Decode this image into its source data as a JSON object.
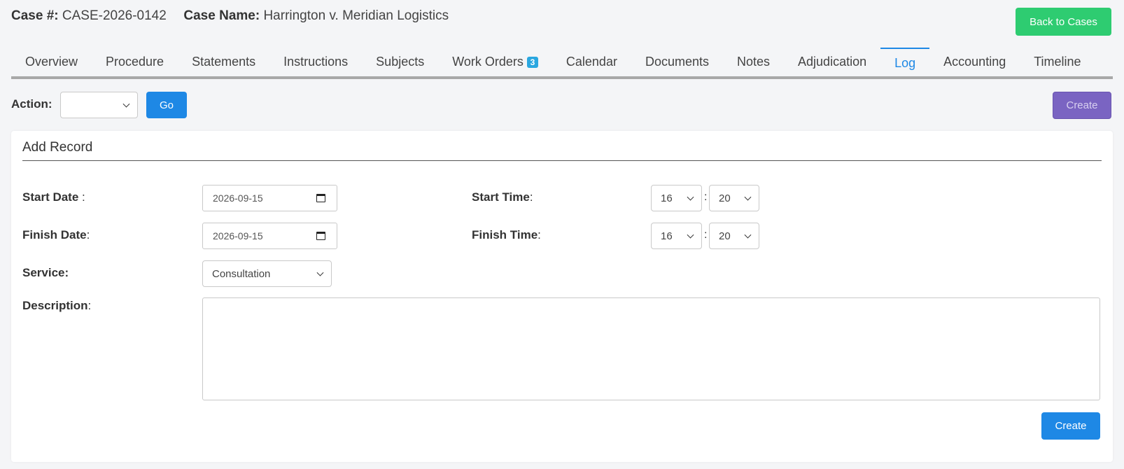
{
  "header": {
    "case_number_label": "Case #:",
    "case_number": "CASE-2026-0142",
    "case_name_label": "Case Name:",
    "case_name": "Harrington v. Meridian Logistics",
    "back_button": "Back to Cases"
  },
  "tabs": [
    {
      "label": "Overview"
    },
    {
      "label": "Procedure"
    },
    {
      "label": "Statements"
    },
    {
      "label": "Instructions"
    },
    {
      "label": "Subjects"
    },
    {
      "label": "Work Orders",
      "badge": "3"
    },
    {
      "label": "Calendar"
    },
    {
      "label": "Documents"
    },
    {
      "label": "Notes"
    },
    {
      "label": "Adjudication"
    },
    {
      "label": "Log",
      "active": true
    },
    {
      "label": "Accounting"
    },
    {
      "label": "Timeline"
    }
  ],
  "toolbar": {
    "action_label": "Action:",
    "action_value": "",
    "go_label": "Go",
    "create_label": "Create"
  },
  "form": {
    "title": "Add Record",
    "start_date_label": "Start Date",
    "start_date_suffix": " :",
    "start_date_value": "2026-09-15",
    "finish_date_label": "Finish Date",
    "finish_date_suffix": ":",
    "finish_date_value": "2026-09-15",
    "start_time_label": "Start Time",
    "start_time_suffix": ":",
    "start_hour": "16",
    "start_minute": "20",
    "finish_time_label": "Finish Time",
    "finish_time_suffix": ":",
    "finish_hour": "16",
    "finish_minute": "20",
    "time_separator": ":",
    "service_label": "Service:",
    "service_value": "Consultation",
    "description_label": "Description",
    "description_suffix": ":",
    "description_value": "",
    "create_label": "Create"
  },
  "colors": {
    "primary": "#1e88e5",
    "success": "#2ecc71",
    "purple": "#7a64c2",
    "badge": "#2aa7e0"
  }
}
